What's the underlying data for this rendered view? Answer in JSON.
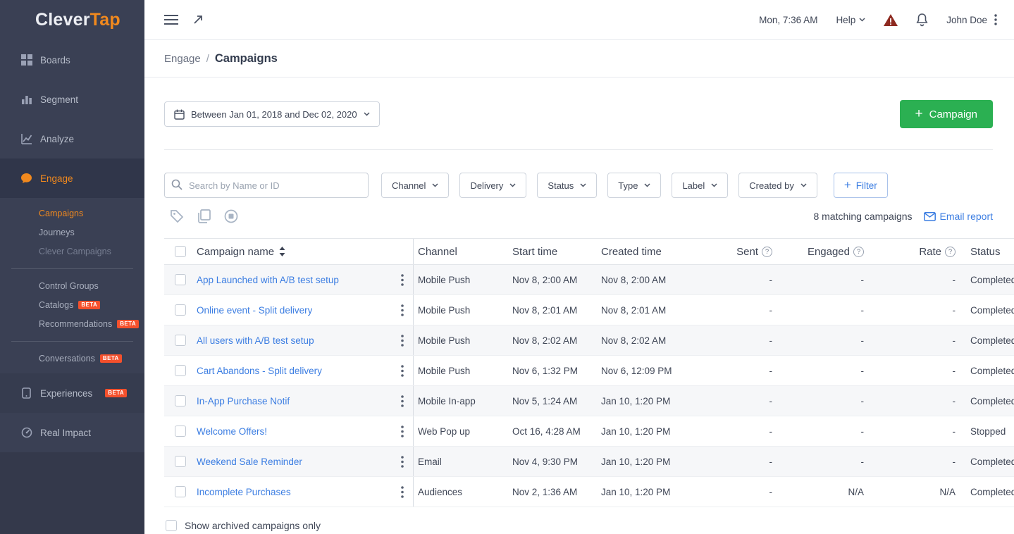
{
  "colors": {
    "sidebar-bg": "#3a4054",
    "sidebar-active": "#30364a",
    "accent-orange": "#f1891e",
    "accent-green": "#2bb052",
    "link-blue": "#3b7de2",
    "badge-red": "#f4502c",
    "text-dark": "#3f4656"
  },
  "glyphs": {
    "question": "?",
    "plus": "+"
  },
  "brand": {
    "name_primary": "Clever",
    "name_secondary": "Tap"
  },
  "topbar": {
    "datetime": "Mon, 7:36 AM",
    "help_label": "Help",
    "user_name": "John Doe"
  },
  "breadcrumb": {
    "parent": "Engage",
    "separator": "/",
    "current": "Campaigns"
  },
  "sidebar": {
    "main_items": [
      {
        "label": "Boards"
      },
      {
        "label": "Segment"
      },
      {
        "label": "Analyze"
      },
      {
        "label": "Engage"
      }
    ],
    "engage_children": [
      {
        "label": "Campaigns",
        "state": "active"
      },
      {
        "label": "Journeys"
      },
      {
        "label": "Clever Campaigns",
        "state": "dimmed"
      }
    ],
    "group2": [
      {
        "label": "Control Groups"
      },
      {
        "label": "Catalogs",
        "badge": "BETA"
      },
      {
        "label": "Recommendations",
        "badge": "BETA"
      }
    ],
    "group3": [
      {
        "label": "Conversations",
        "badge": "BETA"
      }
    ],
    "bottom_items": [
      {
        "label": "Experiences",
        "badge": "BETA"
      },
      {
        "label": "Real Impact"
      }
    ]
  },
  "toolbar": {
    "date_range_label": "Between Jan 01, 2018 and Dec 02, 2020",
    "new_campaign_label": "Campaign",
    "search_placeholder": "Search by Name or ID",
    "filter_dropdowns": [
      {
        "label": "Channel"
      },
      {
        "label": "Delivery"
      },
      {
        "label": "Status"
      },
      {
        "label": "Type"
      },
      {
        "label": "Label"
      },
      {
        "label": "Created by"
      }
    ],
    "add_filter_label": "Filter",
    "matching_count_label": "8 matching campaigns",
    "email_report_label": "Email report"
  },
  "table": {
    "headers": {
      "name": "Campaign name",
      "channel": "Channel",
      "start": "Start time",
      "created": "Created time",
      "sent": "Sent",
      "engaged": "Engaged",
      "rate": "Rate",
      "status": "Status"
    },
    "rows": [
      {
        "name": "App Launched with A/B test setup",
        "channel": "Mobile Push",
        "start": "Nov 8, 2:00 AM",
        "created": "Nov 8, 2:00 AM",
        "sent": "-",
        "engaged": "-",
        "rate": "-",
        "status": "Completed"
      },
      {
        "name": "Online event - Split delivery",
        "channel": "Mobile Push",
        "start": "Nov 8, 2:01 AM",
        "created": "Nov 8, 2:01 AM",
        "sent": "-",
        "engaged": "-",
        "rate": "-",
        "status": "Completed"
      },
      {
        "name": "All users with A/B test setup",
        "channel": "Mobile Push",
        "start": "Nov 8, 2:02 AM",
        "created": "Nov 8, 2:02 AM",
        "sent": "-",
        "engaged": "-",
        "rate": "-",
        "status": "Completed"
      },
      {
        "name": "Cart Abandons - Split delivery",
        "channel": "Mobile Push",
        "start": "Nov 6, 1:32 PM",
        "created": "Nov 6, 12:09 PM",
        "sent": "-",
        "engaged": "-",
        "rate": "-",
        "status": "Completed"
      },
      {
        "name": "In-App Purchase Notif",
        "channel": "Mobile In-app",
        "start": "Nov 5, 1:24 AM",
        "created": "Jan 10, 1:20 PM",
        "sent": "-",
        "engaged": "-",
        "rate": "-",
        "status": "Completed"
      },
      {
        "name": "Welcome Offers!",
        "channel": "Web Pop up",
        "start": "Oct 16, 4:28 AM",
        "created": "Jan 10, 1:20 PM",
        "sent": "-",
        "engaged": "-",
        "rate": "-",
        "status": "Stopped"
      },
      {
        "name": "Weekend Sale Reminder",
        "channel": "Email",
        "start": "Nov 4, 9:30 PM",
        "created": "Jan 10, 1:20 PM",
        "sent": "-",
        "engaged": "-",
        "rate": "-",
        "status": "Completed"
      },
      {
        "name": "Incomplete Purchases",
        "channel": "Audiences",
        "start": "Nov 2, 1:36 AM",
        "created": "Jan 10, 1:20 PM",
        "sent": "-",
        "engaged": "N/A",
        "rate": "N/A",
        "status": "Completed"
      }
    ],
    "archived_checkbox_label": "Show archived campaigns only"
  }
}
